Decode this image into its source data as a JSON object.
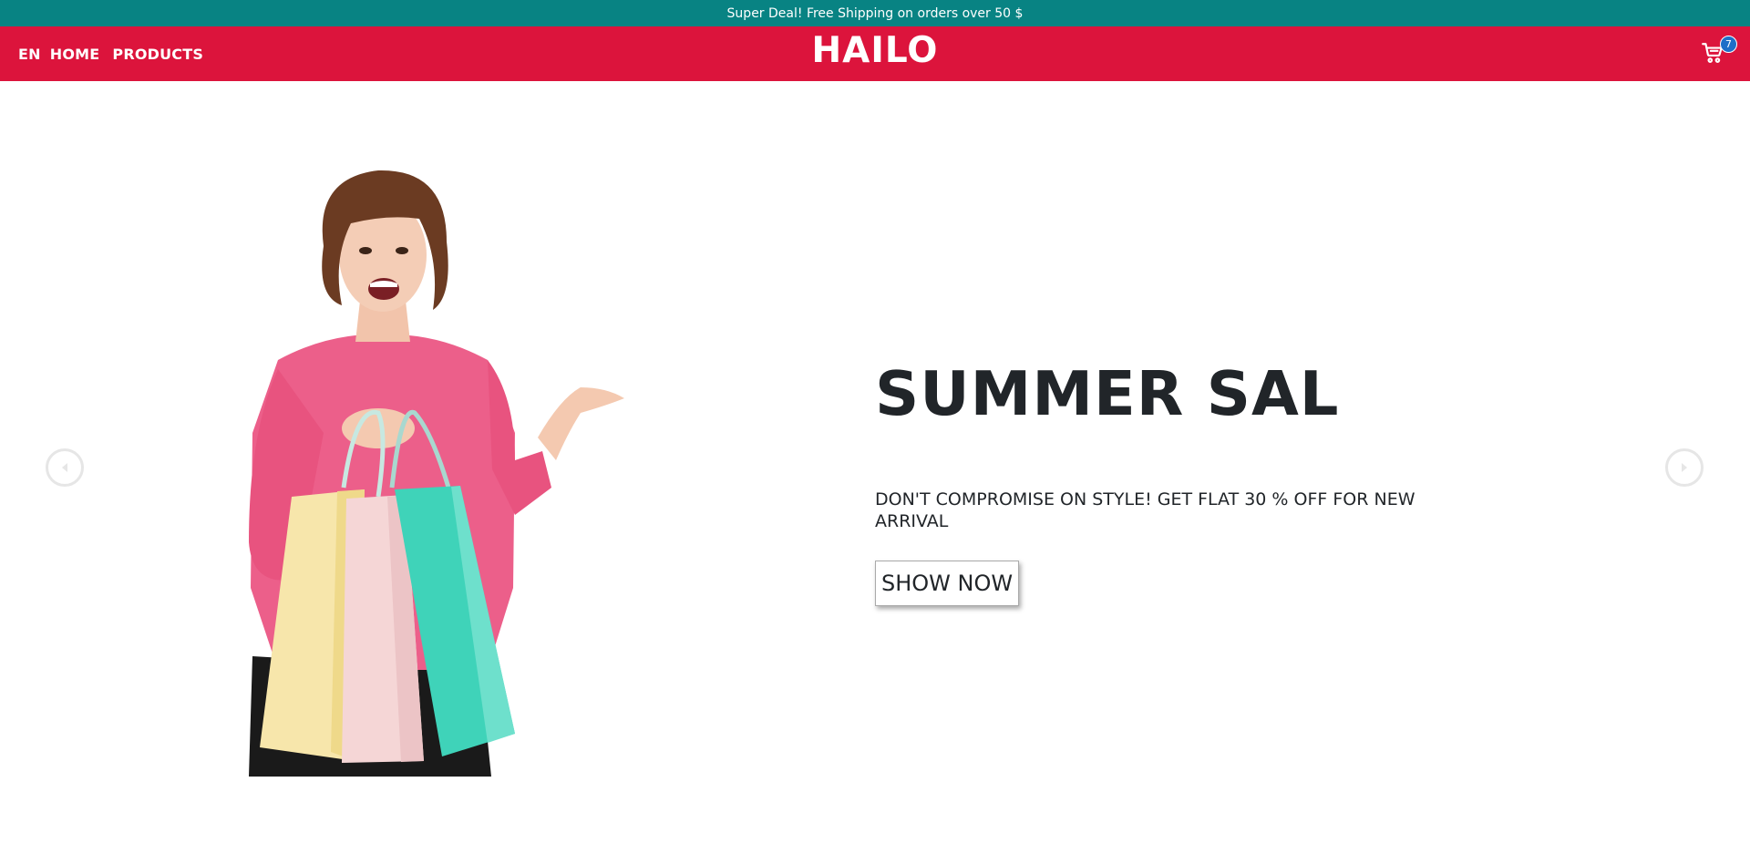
{
  "promo_bar": {
    "text": "Super Deal! Free Shipping on orders over 50 $"
  },
  "navbar": {
    "language": "EN",
    "links": [
      "HOME",
      "PRODUCTS"
    ],
    "logo": "HAILO",
    "cart_count": "7",
    "cart_icon": "cart-icon"
  },
  "hero": {
    "title": "SUMMER SAL",
    "subtitle": "DON'T COMPROMISE ON STYLE! GET FLAT 30 % OFF FOR NEW ARRIVAL",
    "button_label": "SHOW NOW",
    "prev_icon": "chevron-left-icon",
    "next_icon": "chevron-right-icon"
  },
  "colors": {
    "promo_bg": "#088383",
    "nav_bg": "#dc143c",
    "badge_bg": "#1e6fc8",
    "text_dark": "#212529"
  }
}
